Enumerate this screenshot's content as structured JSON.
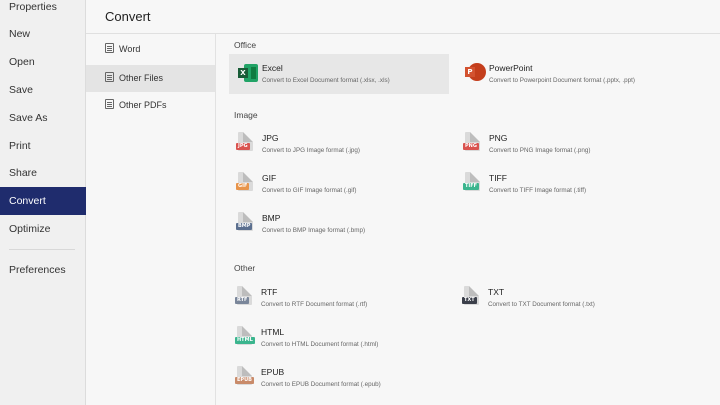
{
  "nav": {
    "items": [
      {
        "label": "Properties"
      },
      {
        "label": "New"
      },
      {
        "label": "Open"
      },
      {
        "label": "Save"
      },
      {
        "label": "Save As"
      },
      {
        "label": "Print"
      },
      {
        "label": "Share"
      },
      {
        "label": "Convert"
      },
      {
        "label": "Optimize"
      },
      {
        "label": "Preferences"
      }
    ],
    "active": "Convert"
  },
  "header": {
    "title": "Convert"
  },
  "subnav": {
    "items": [
      {
        "label": "Word"
      },
      {
        "label": "Other Files"
      },
      {
        "label": "Other PDFs"
      }
    ],
    "active": "Other Files"
  },
  "sections": {
    "office": {
      "title": "Office",
      "cards": [
        {
          "title": "Excel",
          "desc": "Convert to Excel Document format (.xlsx, .xls)",
          "icon": "excel-icon",
          "color": "#21a366"
        },
        {
          "title": "PowerPoint",
          "desc": "Convert to Powerpoint Document format (.pptx, .ppt)",
          "icon": "powerpoint-icon",
          "color": "#c43e1c"
        }
      ]
    },
    "image": {
      "title": "Image",
      "cards": [
        {
          "title": "JPG",
          "desc": "Convert to JPG Image format (.jpg)",
          "tag": "JPG",
          "color": "#d9534f"
        },
        {
          "title": "PNG",
          "desc": "Convert to PNG Image format (.png)",
          "tag": "PNG",
          "color": "#d9534f"
        },
        {
          "title": "GIF",
          "desc": "Convert to GIF Image format (.gif)",
          "tag": "GIF",
          "color": "#e8944a"
        },
        {
          "title": "TIFF",
          "desc": "Convert to TIFF Image format (.tiff)",
          "tag": "TIFF",
          "color": "#3bb58e"
        },
        {
          "title": "BMP",
          "desc": "Convert to BMP Image format (.bmp)",
          "tag": "BMP",
          "color": "#5b6f8f"
        }
      ]
    },
    "other": {
      "title": "Other",
      "cards": [
        {
          "title": "RTF",
          "desc": "Convert to RTF Document format (.rtf)",
          "tag": "RTF",
          "color": "#7a869a"
        },
        {
          "title": "TXT",
          "desc": "Convert to TXT Document format (.txt)",
          "tag": "TXT",
          "color": "#3b3f4a"
        },
        {
          "title": "HTML",
          "desc": "Convert to HTML Document format (.html)",
          "tag": "HTML",
          "color": "#3bb58e"
        },
        {
          "title": "EPUB",
          "desc": "Convert to EPUB Document format (.epub)",
          "tag": "EPUB",
          "color": "#c98b6a"
        }
      ]
    }
  }
}
